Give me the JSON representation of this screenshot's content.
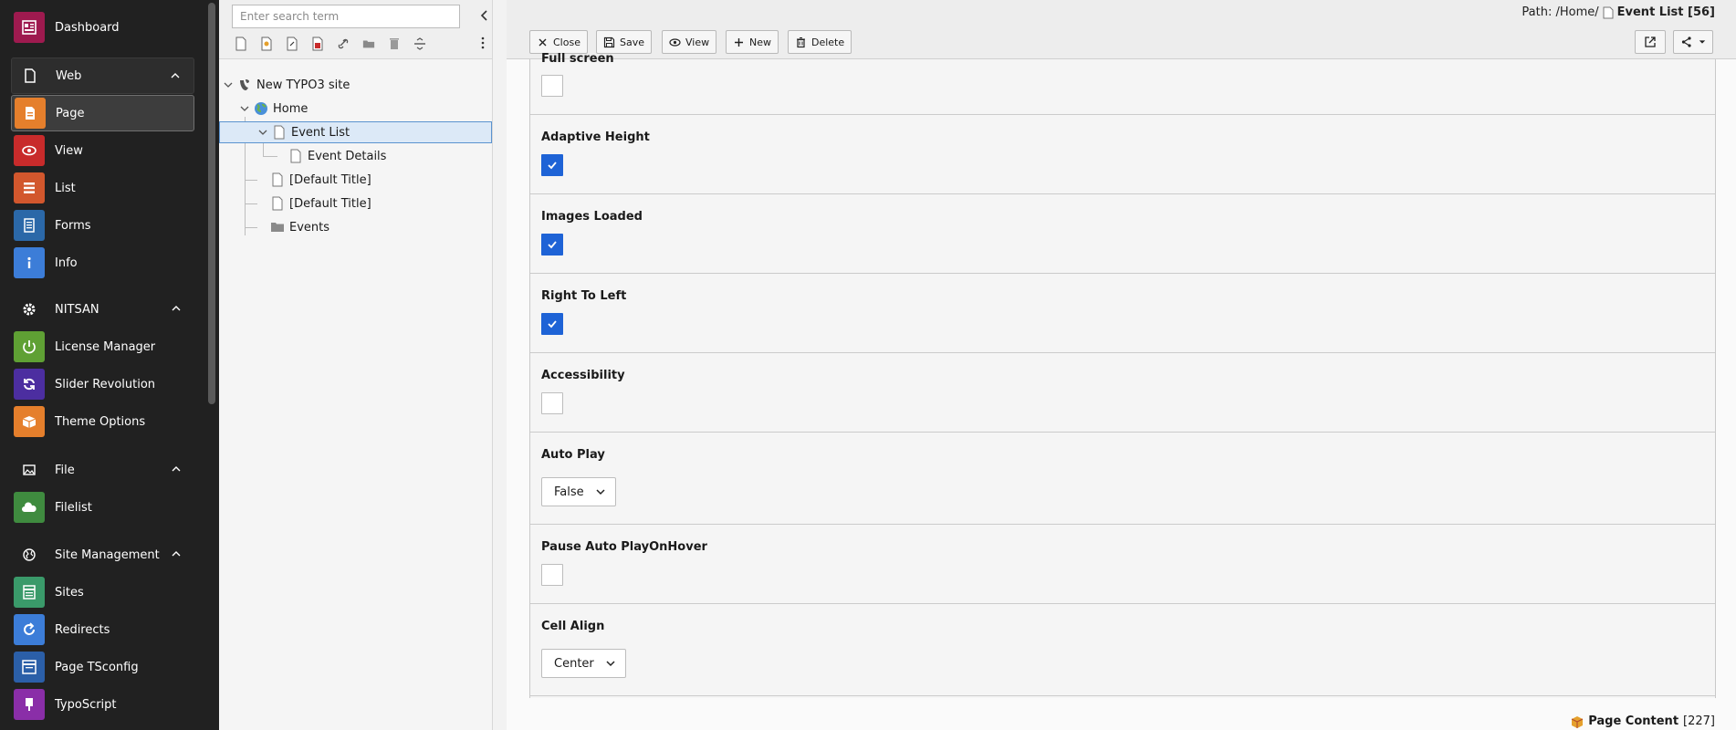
{
  "module_menu": {
    "items": [
      {
        "id": "dashboard",
        "label": "Dashboard",
        "color": "#9e1a4f",
        "icon": "dashboard-icon"
      },
      {
        "id": "page",
        "label": "Page",
        "color": "#e57f2c",
        "icon": "page-module-icon"
      },
      {
        "id": "view",
        "label": "View",
        "color": "#c82b2b",
        "icon": "eye-icon"
      },
      {
        "id": "list",
        "label": "List",
        "color": "#d2572d",
        "icon": "list-icon"
      },
      {
        "id": "forms",
        "label": "Forms",
        "color": "#2b68a8",
        "icon": "forms-icon"
      },
      {
        "id": "info",
        "label": "Info",
        "color": "#3c7dd8",
        "icon": "info-icon"
      },
      {
        "id": "license",
        "label": "License Manager",
        "color": "#5fa034",
        "icon": "power-icon"
      },
      {
        "id": "slider",
        "label": "Slider Revolution",
        "color": "#4c2ea0",
        "icon": "refresh-icon"
      },
      {
        "id": "theme",
        "label": "Theme Options",
        "color": "#e57f2c",
        "icon": "box-icon"
      },
      {
        "id": "filelist",
        "label": "Filelist",
        "color": "#3f8b3f",
        "icon": "cloud-icon"
      },
      {
        "id": "sites",
        "label": "Sites",
        "color": "#3a9a6a",
        "icon": "sites-icon"
      },
      {
        "id": "redirects",
        "label": "Redirects",
        "color": "#3c7dd8",
        "icon": "redirect-icon"
      },
      {
        "id": "tsconfig",
        "label": "Page TSconfig",
        "color": "#2b5fa8",
        "icon": "tsconfig-icon"
      },
      {
        "id": "typoscript",
        "label": "TypoScript",
        "color": "#8a2ea8",
        "icon": "typoscript-icon"
      }
    ],
    "groups": [
      {
        "id": "web",
        "label": "Web",
        "icon": "page-icon"
      },
      {
        "id": "nitsan",
        "label": "NITSAN",
        "icon": "gear-icon"
      },
      {
        "id": "file",
        "label": "File",
        "icon": "image-icon"
      },
      {
        "id": "site",
        "label": "Site Management",
        "icon": "globe-icon"
      }
    ]
  },
  "tree": {
    "search_placeholder": "Enter search term",
    "nodes": [
      {
        "label": "New TYPO3 site"
      },
      {
        "label": "Home"
      },
      {
        "label": "Event List"
      },
      {
        "label": "Event Details"
      },
      {
        "label": "[Default Title]"
      },
      {
        "label": "[Default Title]"
      },
      {
        "label": "Events"
      }
    ]
  },
  "header": {
    "path_prefix": "Path: /Home/",
    "page_title": "Event List [56]",
    "buttons": {
      "close": "Close",
      "save": "Save",
      "view": "View",
      "new": "New",
      "delete": "Delete"
    }
  },
  "form": {
    "fields": [
      {
        "label": "Full screen",
        "type": "checkbox",
        "checked": false
      },
      {
        "label": "Adaptive Height",
        "type": "checkbox",
        "checked": true
      },
      {
        "label": "Images Loaded",
        "type": "checkbox",
        "checked": true
      },
      {
        "label": "Right To Left",
        "type": "checkbox",
        "checked": true
      },
      {
        "label": "Accessibility",
        "type": "checkbox",
        "checked": false
      },
      {
        "label": "Auto Play",
        "type": "select",
        "value": "False"
      },
      {
        "label": "Pause Auto PlayOnHover",
        "type": "checkbox",
        "checked": false
      },
      {
        "label": "Cell Align",
        "type": "select",
        "value": "Center"
      }
    ]
  },
  "footer": {
    "label": "Page Content",
    "count": "[227]"
  },
  "colors": {
    "accent": "#1e63d6",
    "sidebar_bg": "#212121"
  }
}
